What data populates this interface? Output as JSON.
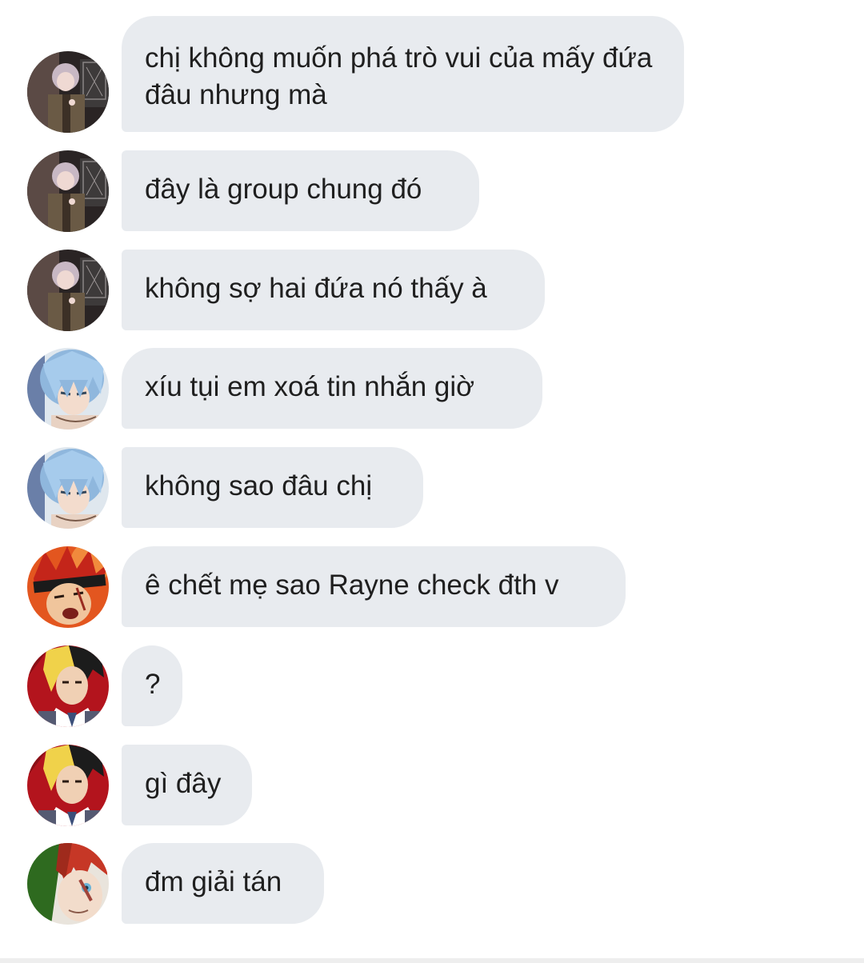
{
  "messages": [
    {
      "text": "chị không muốn phá trò vui của mấy đứa đâu nhưng mà",
      "avatar": "silver-hair-character-avatar"
    },
    {
      "text": "đây là group chung đó",
      "avatar": "silver-hair-character-avatar"
    },
    {
      "text": "không sợ hai đứa nó thấy à",
      "avatar": "silver-hair-character-avatar"
    },
    {
      "text": "xíu tụi em xoá tin nhắn giờ",
      "avatar": "blue-hair-character-avatar"
    },
    {
      "text": "không sao đâu chị",
      "avatar": "blue-hair-character-avatar"
    },
    {
      "text": "ê chết mẹ sao Rayne check đth v",
      "avatar": "red-hair-headband-character-avatar"
    },
    {
      "text": "?",
      "avatar": "blonde-black-hair-character-avatar"
    },
    {
      "text": "gì đây",
      "avatar": "blonde-black-hair-character-avatar"
    },
    {
      "text": "đm giải tán",
      "avatar": "red-white-hair-character-avatar"
    }
  ],
  "colors": {
    "bubble": "#e8ebef",
    "text": "#1f1f1f",
    "background": "#ffffff"
  }
}
